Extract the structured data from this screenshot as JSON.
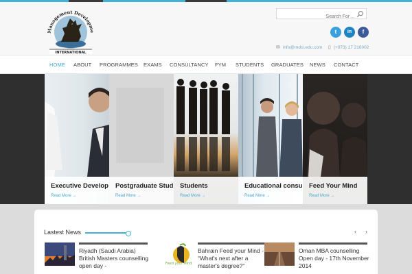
{
  "colors": {
    "accent": "#44b0d6",
    "twitter": "#3aa0dc",
    "linkedin": "#1e83c3",
    "facebook": "#3b5a9a"
  },
  "header": {
    "logo_text": "Management Development Centre",
    "logo_sub": "INTERNATIONAL",
    "search_placeholder": "Search For ..",
    "social": [
      {
        "icon": "twitter-icon",
        "glyph": "t"
      },
      {
        "icon": "linkedin-icon",
        "glyph": "in"
      },
      {
        "icon": "facebook-icon",
        "glyph": "f"
      }
    ],
    "email": "info@mdci.edu.com",
    "phone": "(+973) 17 216002"
  },
  "nav": {
    "items": [
      {
        "label": "HOME",
        "active": true
      },
      {
        "label": "ABOUT"
      },
      {
        "label": "PROGRAMMES"
      },
      {
        "label": "EXAMS"
      },
      {
        "label": "CONSULTANCY"
      },
      {
        "label": "FYM"
      },
      {
        "label": "STUDENTS"
      },
      {
        "label": "GRADUATES"
      },
      {
        "label": "NEWS"
      },
      {
        "label": "CONTACT"
      }
    ]
  },
  "slider": {
    "panels": [
      {
        "title": "Executive Develop",
        "more": "Read More →"
      },
      {
        "title": "Postgraduate Studi",
        "more": "Read More →"
      },
      {
        "title": "Students",
        "more": "Read More →"
      },
      {
        "title": "Educational consult",
        "more": "Read More →"
      },
      {
        "title": "Feed Your Mind",
        "more": "Read More →"
      }
    ]
  },
  "news": {
    "title": "Lastest News",
    "prev": "‹",
    "next": "›",
    "items": [
      {
        "text": "Riyadh (Saudi Arabia) British Masters counselling open day -"
      },
      {
        "text": "Bahrain Feed your Mind - “What's next after a master's degree?”",
        "thumb_label": "Feed your Mind"
      },
      {
        "text": "Oman MBA counselling Open day - 17th November 2014"
      }
    ]
  }
}
